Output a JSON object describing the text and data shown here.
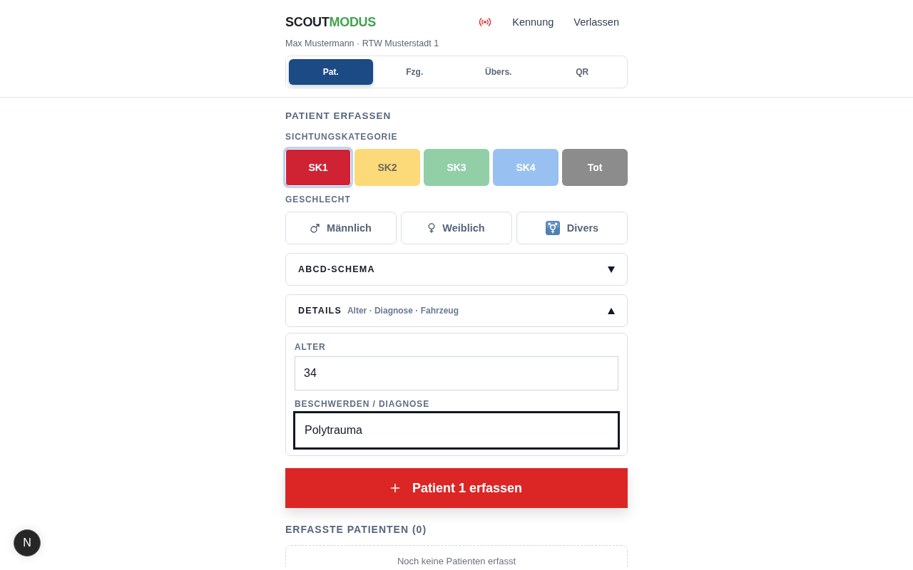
{
  "header": {
    "logo": {
      "text": "SCOUT",
      "highlight": "MODUS"
    },
    "nav_buttons": [
      "Kennung",
      "Verlassen"
    ],
    "user_line": "Max Mustermann · RTW Musterstadt 1"
  },
  "tabs": [
    {
      "label": "Pat.",
      "selected": true
    },
    {
      "label": "Fzg.",
      "selected": false
    },
    {
      "label": "Übers.",
      "selected": false
    },
    {
      "label": "QR",
      "selected": false
    }
  ],
  "form": {
    "title": "PATIENT ERFASSEN",
    "triage": {
      "label": "SICHTUNGSKATEGORIE",
      "options": [
        {
          "label": "SK1",
          "color": "#cf2333",
          "selected": true
        },
        {
          "label": "SK2",
          "color": "#fcd979",
          "selected": false
        },
        {
          "label": "SK3",
          "color": "#92cfa7",
          "selected": false
        },
        {
          "label": "SK4",
          "color": "#98c1f2",
          "selected": false
        },
        {
          "label": "Tot",
          "color": "#8c8c8c",
          "selected": false
        }
      ]
    },
    "gender": {
      "label": "GESCHLECHT",
      "options": [
        {
          "label": "Männlich",
          "kind": "male",
          "selected": false
        },
        {
          "label": "Weiblich",
          "kind": "female",
          "selected": false
        },
        {
          "label": "Divers",
          "kind": "diverse",
          "selected": false
        }
      ]
    },
    "sections": [
      {
        "title": "ABCD-SCHEMA",
        "expanded": false
      },
      {
        "title": "DETAILS",
        "subtitle": "Alter · Diagnose · Fahrzeug",
        "expanded": true,
        "fields": [
          {
            "label": "ALTER",
            "value": "34",
            "focused": false
          },
          {
            "label": "BESCHWERDEN / DIAGNOSE",
            "value": "Polytrauma",
            "focused": true
          }
        ]
      }
    ],
    "submit": {
      "label": "Patient 1 erfassen"
    }
  },
  "patients": {
    "title": "ERFASSTE PATIENTEN (0)",
    "empty_text": "Noch keine Patienten erfasst"
  },
  "dev_badge": {
    "label": "N"
  }
}
